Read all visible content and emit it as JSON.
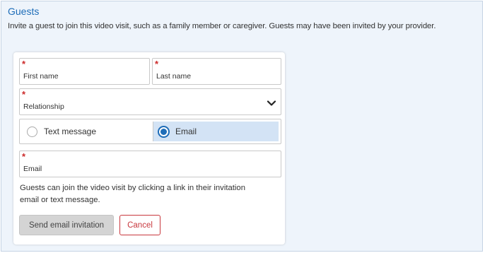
{
  "section": {
    "title": "Guests",
    "description": "Invite a guest to join this video visit, such as a family member or caregiver. Guests may have been invited by your provider."
  },
  "form": {
    "required_marker": "*",
    "first_name_label": "First name",
    "last_name_label": "Last name",
    "relationship_label": "Relationship",
    "contact_method": {
      "options": [
        "Text message",
        "Email"
      ],
      "selected": "Email"
    },
    "email_label": "Email",
    "help_text_line1": "Guests can join the video visit by clicking a link in their invitation",
    "help_text_line2": "email or text message.",
    "send_button_label": "Send email invitation",
    "cancel_button_label": "Cancel"
  },
  "colors": {
    "accent": "#1e6db8",
    "required": "#cc2a2a",
    "cancel": "#c8373d",
    "panel_bg": "#eef4fb",
    "selected_option_bg": "#d3e3f5"
  },
  "icons": {
    "relationship_dropdown": "chevron-down-icon",
    "text_option": "radio-unchecked-icon",
    "email_option": "radio-checked-icon"
  }
}
